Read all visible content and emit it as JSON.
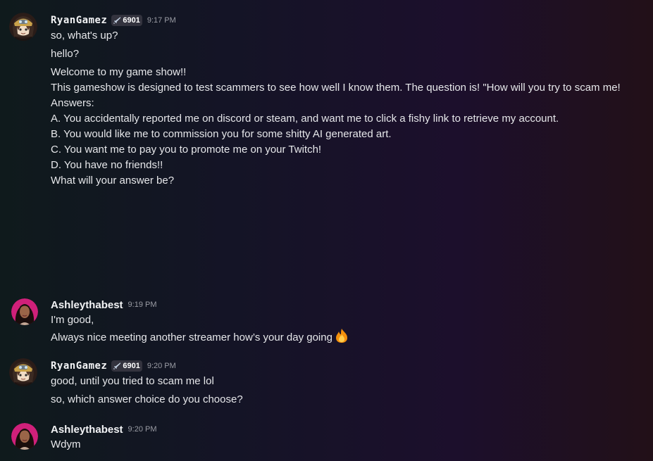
{
  "messages": [
    {
      "user": "RyanGamez",
      "tag": "6901",
      "time": "9:17 PM",
      "lines": [
        "so, what's up?",
        "hello?",
        "Welcome to my game show!!",
        "",
        "This gameshow is designed to test scammers to see how well I know them. The question is! \"How will you try to scam me!",
        "",
        "Answers:",
        "A. You accidentally reported me on discord or steam, and want me to click a fishy link to retrieve my account.",
        "",
        "B. You would like me to commission you for some shitty AI generated art.",
        "",
        "C. You want me to pay you to promote me on your Twitch!",
        "",
        "D. You have no friends!!",
        "",
        "What will your answer be?"
      ]
    },
    {
      "user": "Ashleythabest",
      "time": "9:19 PM",
      "lines": [
        "I'm good,",
        "Always nice meeting another streamer how’s your day going"
      ],
      "emoji": "fire-emoji"
    },
    {
      "user": "RyanGamez",
      "tag": "6901",
      "time": "9:20 PM",
      "lines": [
        "good, until you tried to scam me lol",
        "so, which answer choice do you choose?"
      ]
    },
    {
      "user": "Ashleythabest",
      "time": "9:20 PM",
      "lines": [
        "Wdym"
      ]
    }
  ],
  "colors": {
    "username": "#f2f3f5",
    "text": "#e6e7ea",
    "timestamp": "#9a9ca4",
    "tag_bg": "#33333e"
  }
}
